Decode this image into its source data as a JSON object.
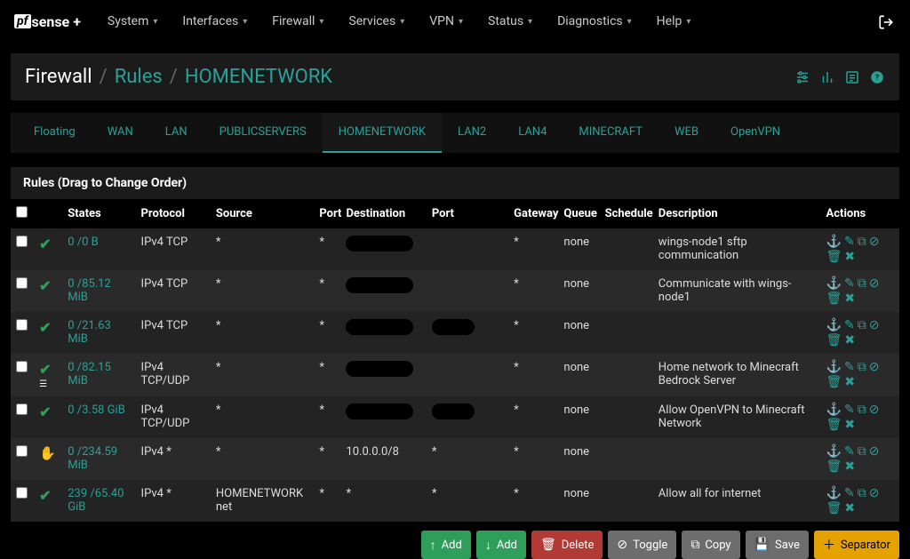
{
  "nav": {
    "items": [
      {
        "label": "System"
      },
      {
        "label": "Interfaces"
      },
      {
        "label": "Firewall"
      },
      {
        "label": "Services"
      },
      {
        "label": "VPN"
      },
      {
        "label": "Status"
      },
      {
        "label": "Diagnostics"
      },
      {
        "label": "Help"
      }
    ]
  },
  "breadcrumb": {
    "root": "Firewall",
    "mid": "Rules",
    "leaf": "HOMENETWORK"
  },
  "tabs": [
    {
      "label": "Floating"
    },
    {
      "label": "WAN"
    },
    {
      "label": "LAN"
    },
    {
      "label": "PUBLICSERVERS"
    },
    {
      "label": "HOMENETWORK",
      "active": true
    },
    {
      "label": "LAN2"
    },
    {
      "label": "LAN4"
    },
    {
      "label": "MINECRAFT"
    },
    {
      "label": "WEB"
    },
    {
      "label": "OpenVPN"
    }
  ],
  "rules": {
    "title": "Rules (Drag to Change Order)",
    "headers": {
      "states": "States",
      "protocol": "Protocol",
      "source": "Source",
      "port1": "Port",
      "destination": "Destination",
      "port2": "Port",
      "gateway": "Gateway",
      "queue": "Queue",
      "schedule": "Schedule",
      "description": "Description",
      "actions": "Actions"
    },
    "rows": [
      {
        "icon": "check",
        "states": "0 /0 B",
        "protocol": "IPv4 TCP",
        "source": "*",
        "port1": "*",
        "dest_redacted": true,
        "port2_redacted": false,
        "port2": "",
        "gateway": "*",
        "queue": "none",
        "description": "wings-node1 sftp communication"
      },
      {
        "icon": "check",
        "states": "0 /85.12 MiB",
        "protocol": "IPv4 TCP",
        "source": "*",
        "port1": "*",
        "dest_redacted": true,
        "port2_redacted": false,
        "port2": "",
        "gateway": "*",
        "queue": "none",
        "description": "Communicate with wings-node1"
      },
      {
        "icon": "check",
        "states": "0 /21.63 MiB",
        "protocol": "IPv4 TCP",
        "source": "*",
        "port1": "*",
        "dest_redacted": true,
        "port2_redacted": true,
        "port2": "",
        "gateway": "*",
        "queue": "none",
        "description": ""
      },
      {
        "icon": "check",
        "extra": "list",
        "states": "0 /82.15 MiB",
        "protocol": "IPv4 TCP/UDP",
        "source": "*",
        "port1": "*",
        "dest_redacted": true,
        "port2_redacted": false,
        "port2": "",
        "gateway": "*",
        "queue": "none",
        "description": "Home network to Minecraft Bedrock Server"
      },
      {
        "icon": "check",
        "states": "0 /3.58 GiB",
        "protocol": "IPv4 TCP/UDP",
        "source": "*",
        "port1": "*",
        "dest_redacted": true,
        "port2_redacted": true,
        "port2": "",
        "gateway": "*",
        "queue": "none",
        "description": "Allow OpenVPN to Minecraft Network"
      },
      {
        "icon": "hand",
        "states": "0 /234.59 MiB",
        "protocol": "IPv4 *",
        "source": "*",
        "port1": "*",
        "dest": "10.0.0.0/8",
        "port2": "*",
        "gateway": "*",
        "queue": "none",
        "description": ""
      },
      {
        "icon": "check",
        "states": "239 /65.40 GiB",
        "protocol": "IPv4 *",
        "source": "HOMENETWORK net",
        "port1": "*",
        "dest": "*",
        "port2": "*",
        "gateway": "*",
        "queue": "none",
        "description": "Allow all for internet"
      }
    ]
  },
  "buttons": {
    "add1": "Add",
    "add2": "Add",
    "delete": "Delete",
    "toggle": "Toggle",
    "copy": "Copy",
    "save": "Save",
    "separator": "Separator"
  }
}
